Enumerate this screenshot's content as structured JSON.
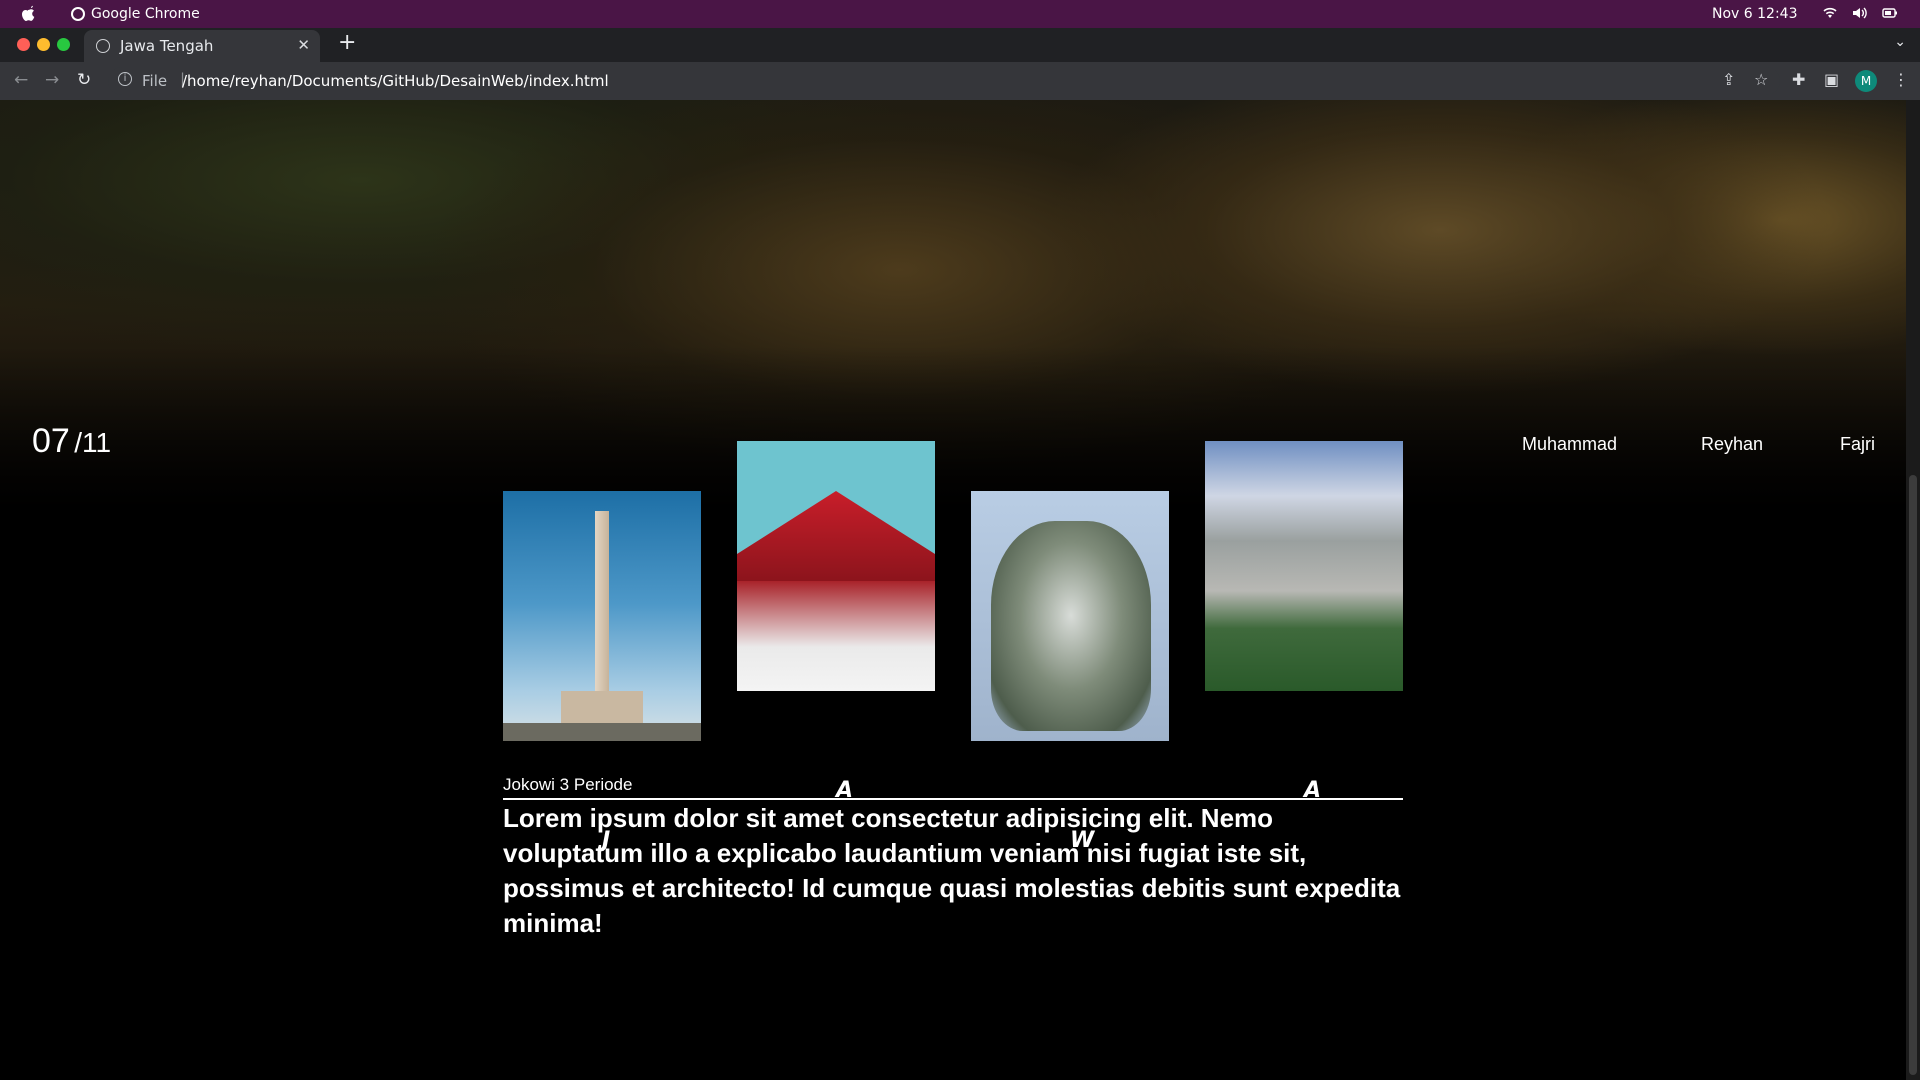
{
  "os_bar": {
    "app_name": "Google Chrome",
    "datetime": "Nov 6  12:43"
  },
  "browser": {
    "tab_title": "Jawa Tengah",
    "scheme_label": "File",
    "url": "/home/reyhan/Documents/GitHub/DesainWeb/index.html",
    "profile_initial": "M",
    "colors": {
      "os_bar": "#4a1546",
      "tabstrip": "#202124",
      "toolbar": "#35363a"
    }
  },
  "hero": {
    "counter_current": "07",
    "counter_total": "/11",
    "nav": [
      "Muhammad",
      "Reyhan",
      "Fajri"
    ]
  },
  "cards": [
    {
      "letter": "J",
      "image": "monument-photo"
    },
    {
      "letter": "A",
      "image": "temple-roof-photo"
    },
    {
      "letter": "W",
      "image": "shark-sculpture-photo"
    },
    {
      "letter": "A",
      "image": "limestone-cliff-lake-photo"
    }
  ],
  "caption": "Jokowi 3 Periode",
  "body_text": "Lorem ipsum dolor sit amet consectetur adipisicing elit. Nemo voluptatum illo a explicabo laudantium veniam nisi fugiat iste sit, possimus et architecto! Id cumque quasi molestias debitis sunt expedita minima!"
}
